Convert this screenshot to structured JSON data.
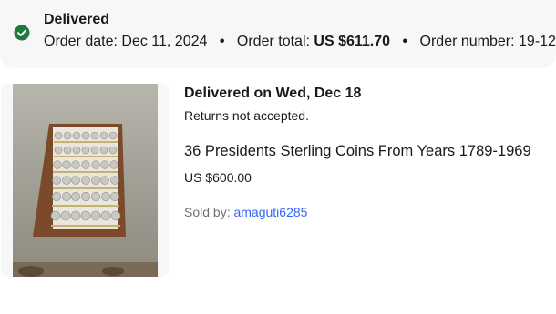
{
  "order": {
    "status": "Delivered",
    "order_date_label": "Order date:",
    "order_date": "Dec 11, 2024",
    "order_total_label": "Order total:",
    "order_total": "US $611.70",
    "order_number_label": "Order number:",
    "order_number": "19-12"
  },
  "item": {
    "delivery": "Delivered on Wed, Dec 18",
    "returns": "Returns not accepted.",
    "title": "36 Presidents Sterling Coins From Years 1789-1969",
    "price": "US $600.00",
    "sold_by_label": "Sold by:",
    "seller": "amaguti6285"
  },
  "icons": {
    "status": "check-circle-icon"
  },
  "colors": {
    "success": "#1d7a3c",
    "link": "#3665f3",
    "header_bg": "#f7f7f7"
  }
}
